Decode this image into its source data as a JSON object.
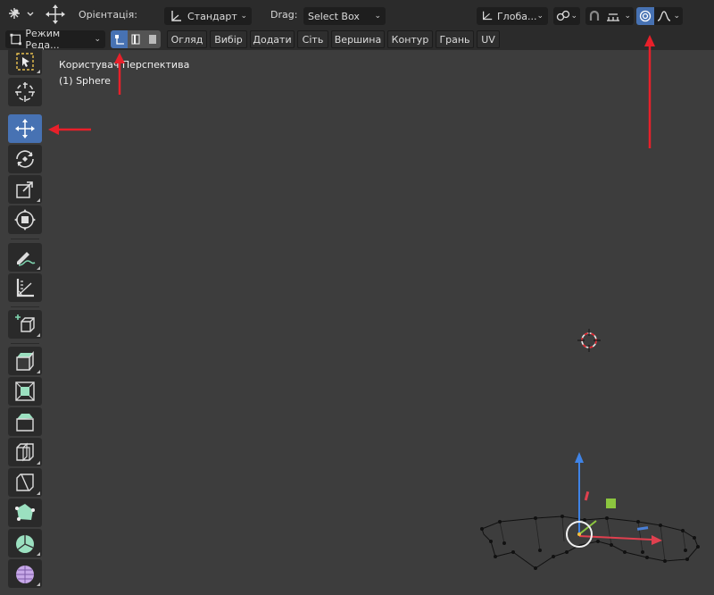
{
  "header": {
    "orientation_label": "Орієнтація:",
    "orientation_value": "Стандарт",
    "drag_label": "Drag:",
    "drag_value": "Select Box",
    "transform_space_value": "Глоба..."
  },
  "subheader": {
    "mode_value": "Режим Реда...",
    "menus": [
      "Огляд",
      "Вибір",
      "Додати",
      "Сіть",
      "Вершина",
      "Контур",
      "Грань",
      "UV"
    ]
  },
  "viewport": {
    "view_name": "Користувач Перспектива",
    "object_name": "(1) Sphere"
  },
  "tools": [
    "select-box",
    "cursor",
    "move",
    "rotate",
    "scale",
    "transform",
    "annotate",
    "measure",
    "add-cube",
    "extrude",
    "inset",
    "bevel",
    "loop-cut",
    "knife",
    "poly-build",
    "spin",
    "smooth"
  ],
  "colors": {
    "accent": "#4772b3",
    "arrow": "#e8202a",
    "gizmo_z": "#3f83e6",
    "gizmo_x": "#e0404f",
    "gizmo_y": "#8cc63f"
  }
}
